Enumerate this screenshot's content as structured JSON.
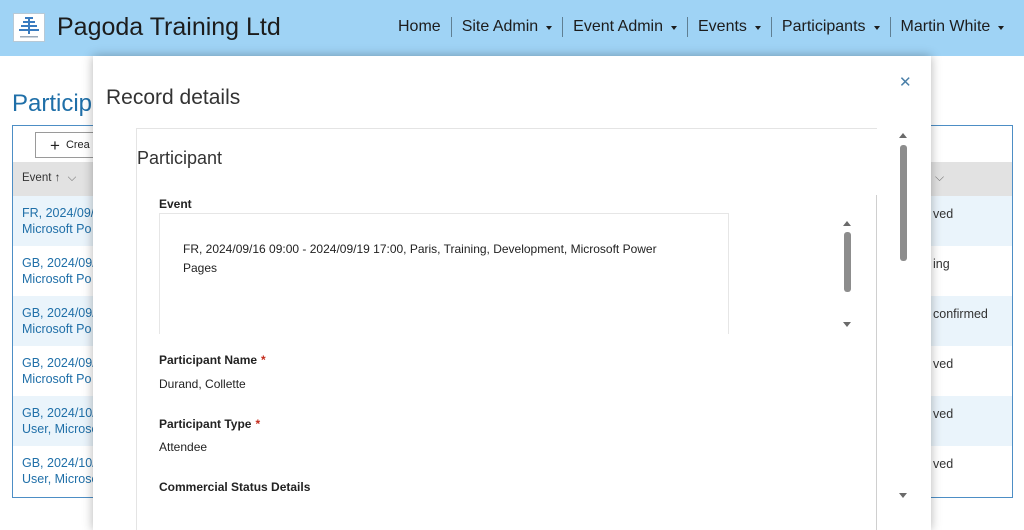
{
  "header": {
    "brand": "Pagoda Training Ltd",
    "nav": [
      {
        "label": "Home",
        "dropdown": false
      },
      {
        "label": "Site Admin",
        "dropdown": true
      },
      {
        "label": "Event Admin",
        "dropdown": true
      },
      {
        "label": "Events",
        "dropdown": true
      },
      {
        "label": "Participants",
        "dropdown": true
      },
      {
        "label": "Martin White",
        "dropdown": true
      }
    ]
  },
  "background": {
    "page_title": "Participa",
    "create_label": "Crea",
    "column_event": "Event ↑",
    "rows": [
      {
        "event_line1": "FR, 2024/09/",
        "event_line2": "Microsoft Po",
        "status": "ved"
      },
      {
        "event_line1": "GB, 2024/09/",
        "event_line2": "Microsoft Po",
        "status": "ing"
      },
      {
        "event_line1": "GB, 2024/09/",
        "event_line2": "Microsoft Po",
        "status": "confirmed"
      },
      {
        "event_line1": "GB, 2024/09/",
        "event_line2": "Microsoft Po",
        "status": "ved"
      },
      {
        "event_line1": "GB, 2024/10/",
        "event_line2": "User, Microso",
        "status": "ved"
      },
      {
        "event_line1": "GB, 2024/10/",
        "event_line2": "User, Microso",
        "status": "ved"
      }
    ]
  },
  "dialog": {
    "title": "Record details",
    "close_icon": "close-icon",
    "section_title": "Participant",
    "fields": {
      "event_label": "Event",
      "event_value_line1": "FR, 2024/09/16 09:00 - 2024/09/19 17:00, Paris, Training, Development, Microsoft Power",
      "event_value_line2": "Pages",
      "participant_name_label": "Participant Name",
      "participant_name_value": "Durand, Collette",
      "participant_type_label": "Participant Type",
      "participant_type_value": "Attendee",
      "commercial_status_label": "Commercial Status Details"
    },
    "required_marker": "*"
  },
  "colors": {
    "header_bg": "#9fd3f5",
    "link": "#1f6fa8",
    "required": "#c42b1c",
    "row_alt": "#eaf4fb"
  }
}
